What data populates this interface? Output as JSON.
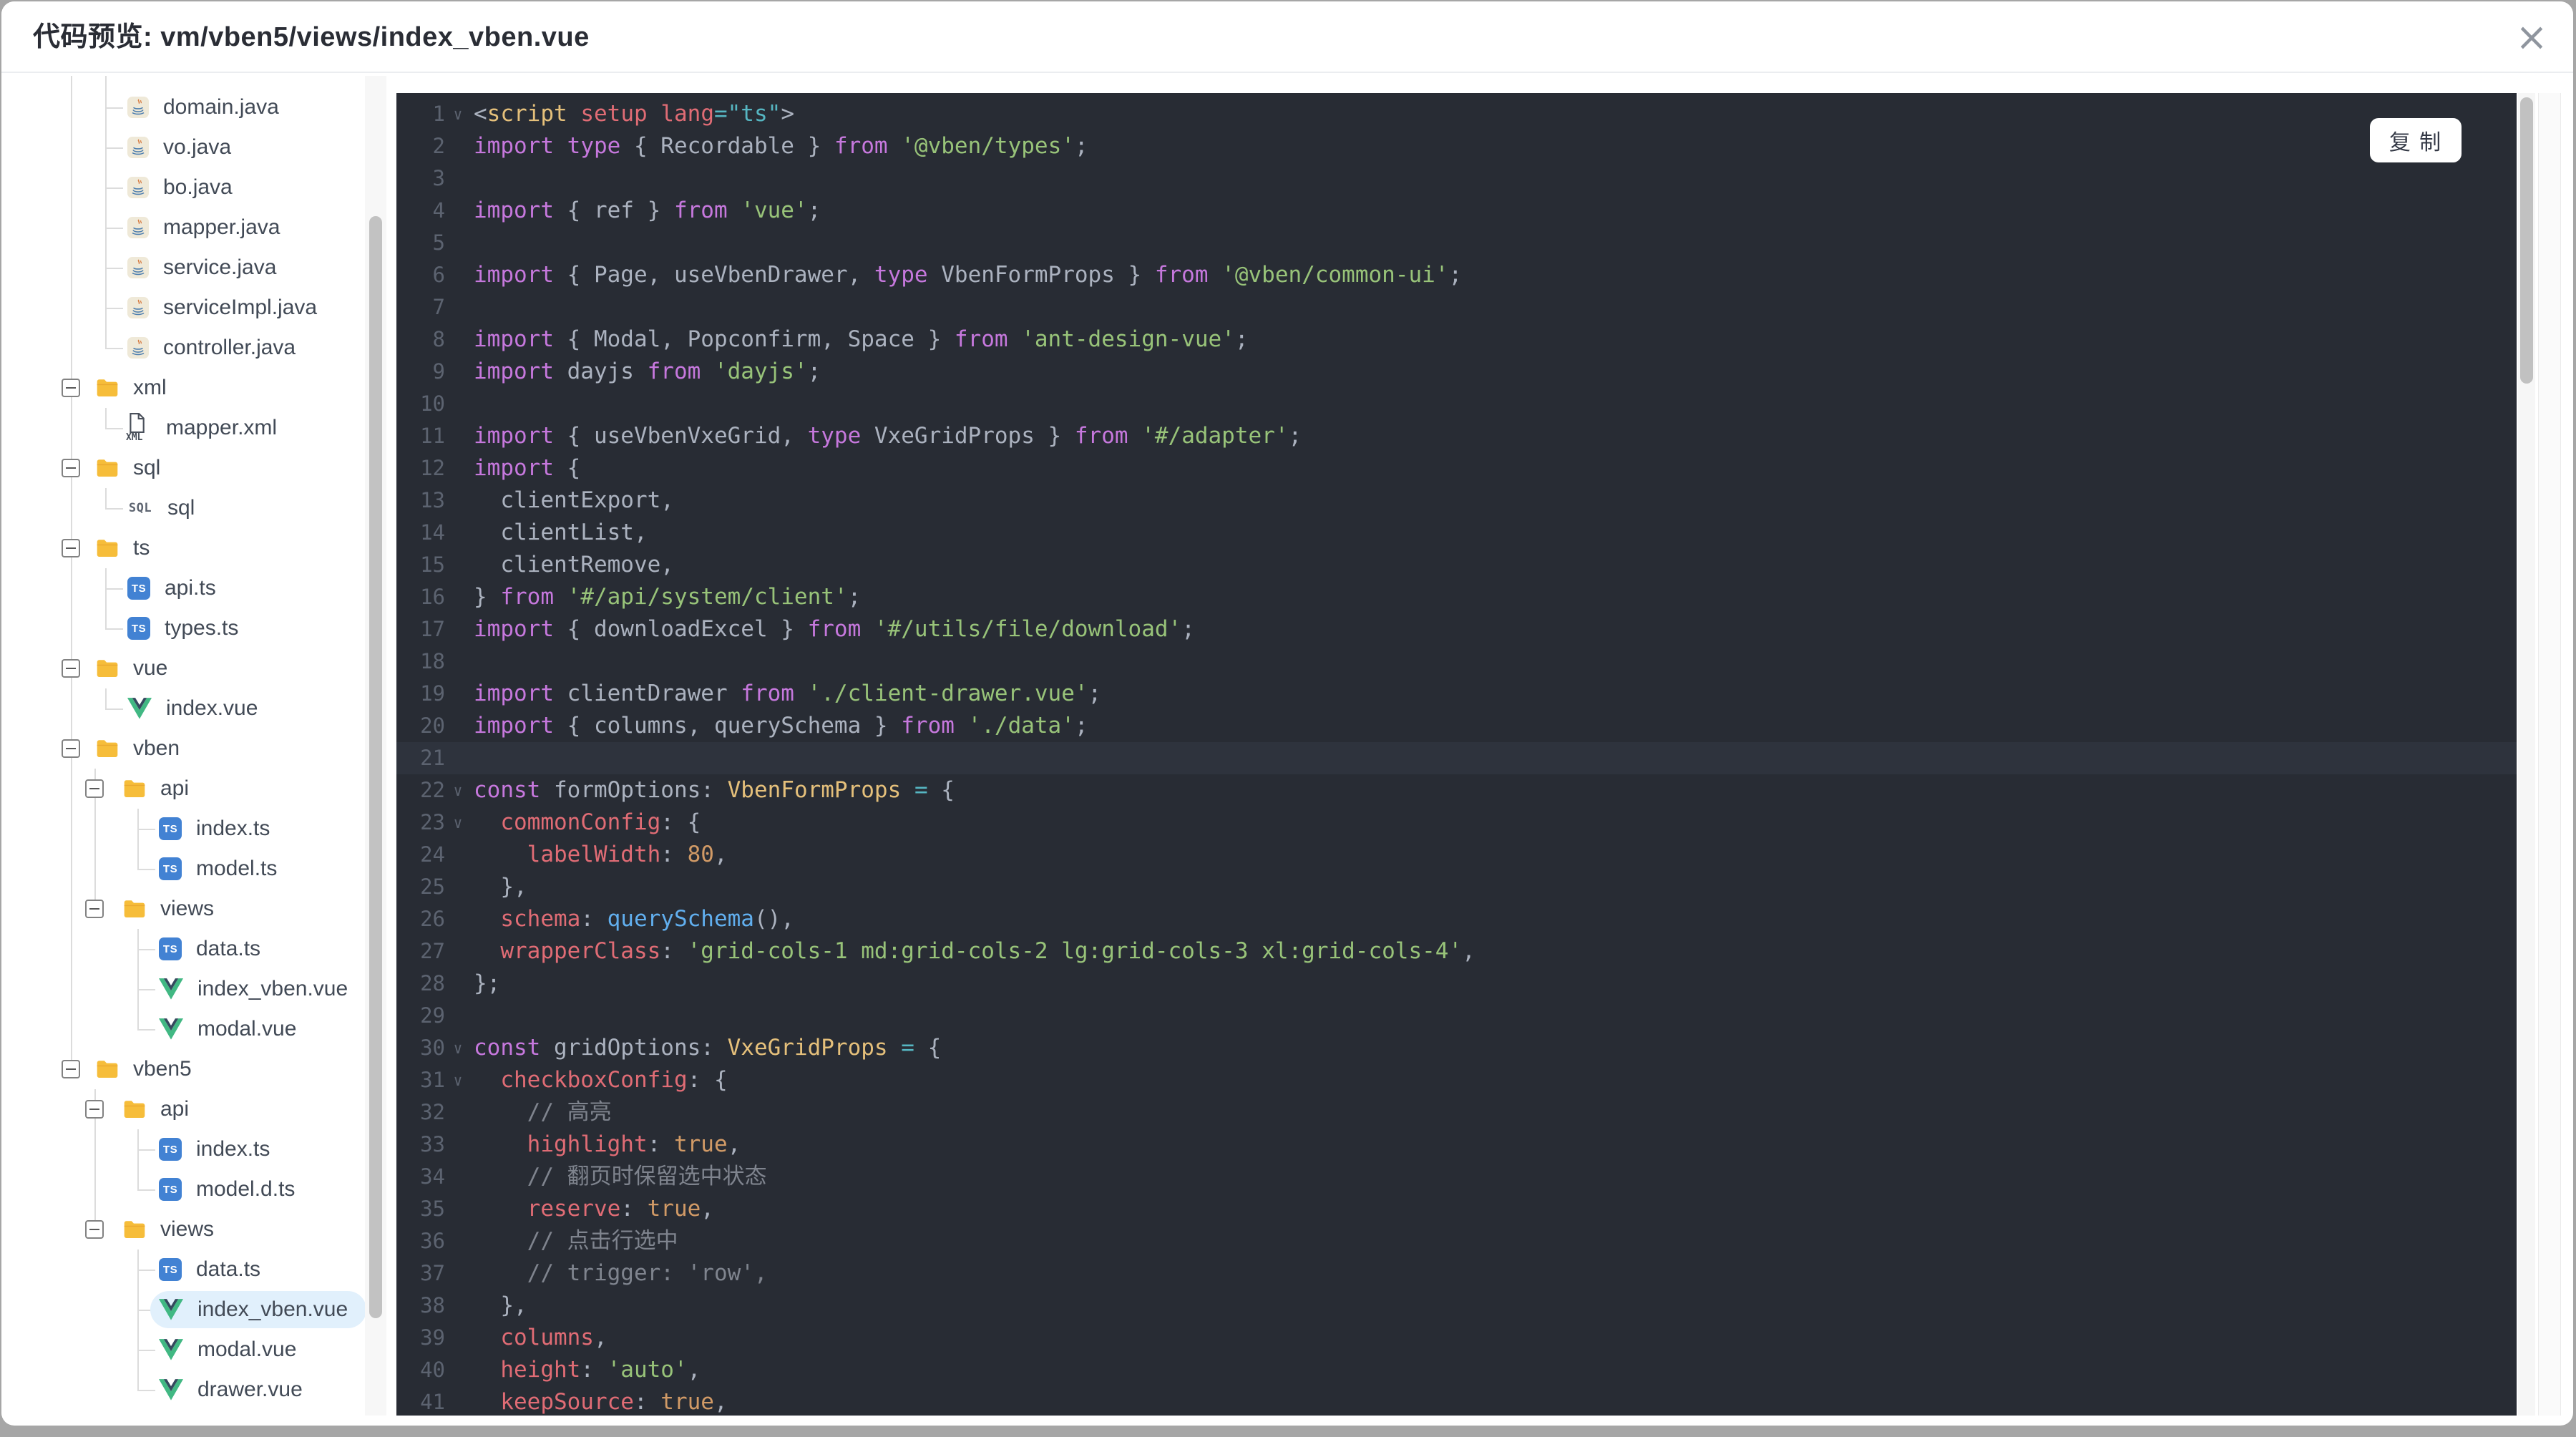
{
  "dialog": {
    "title": "代码预览: vm/vben5/views/index_vben.vue",
    "close_icon": "×"
  },
  "colors": {
    "editor_background": "#282c34",
    "selected_item_bg": "#e1f0fc",
    "folder_icon": "#f6bd3a",
    "ts_icon_bg": "#4282d3",
    "vue_icon_green": "#41b883",
    "vue_icon_dark": "#35495e",
    "syntax_keyword": "#c678dd",
    "syntax_string": "#98c379",
    "syntax_property": "#e06c75",
    "syntax_number": "#d19a66",
    "syntax_function": "#61afef",
    "syntax_type": "#e5c07b",
    "syntax_operator": "#56b6c2",
    "syntax_comment": "#7f848e"
  },
  "tree": {
    "items": [
      {
        "label": "domain.java",
        "kind": "java",
        "level": 1
      },
      {
        "label": "vo.java",
        "kind": "java",
        "level": 1
      },
      {
        "label": "bo.java",
        "kind": "java",
        "level": 1
      },
      {
        "label": "mapper.java",
        "kind": "java",
        "level": 1
      },
      {
        "label": "service.java",
        "kind": "java",
        "level": 1
      },
      {
        "label": "serviceImpl.java",
        "kind": "java",
        "level": 1
      },
      {
        "label": "controller.java",
        "kind": "java",
        "level": 1
      },
      {
        "label": "xml",
        "kind": "folder",
        "level": 0,
        "expander": true
      },
      {
        "label": "mapper.xml",
        "kind": "xml",
        "level": 1
      },
      {
        "label": "sql",
        "kind": "folder",
        "level": 0,
        "expander": true
      },
      {
        "label": "sql",
        "kind": "sql",
        "level": 1
      },
      {
        "label": "ts",
        "kind": "folder",
        "level": 0,
        "expander": true
      },
      {
        "label": "api.ts",
        "kind": "ts",
        "level": 1
      },
      {
        "label": "types.ts",
        "kind": "ts",
        "level": 1
      },
      {
        "label": "vue",
        "kind": "folder",
        "level": 0,
        "expander": true
      },
      {
        "label": "index.vue",
        "kind": "vue",
        "level": 1
      },
      {
        "label": "vben",
        "kind": "folder",
        "level": 0,
        "expander": true
      },
      {
        "label": "api",
        "kind": "folder",
        "level": 1,
        "expander": true
      },
      {
        "label": "index.ts",
        "kind": "ts",
        "level": 2
      },
      {
        "label": "model.ts",
        "kind": "ts",
        "level": 2
      },
      {
        "label": "views",
        "kind": "folder",
        "level": 1,
        "expander": true
      },
      {
        "label": "data.ts",
        "kind": "ts",
        "level": 2
      },
      {
        "label": "index_vben.vue",
        "kind": "vue",
        "level": 2
      },
      {
        "label": "modal.vue",
        "kind": "vue",
        "level": 2
      },
      {
        "label": "vben5",
        "kind": "folder",
        "level": 0,
        "expander": true
      },
      {
        "label": "api",
        "kind": "folder",
        "level": 1,
        "expander": true
      },
      {
        "label": "index.ts",
        "kind": "ts",
        "level": 2
      },
      {
        "label": "model.d.ts",
        "kind": "ts",
        "level": 2
      },
      {
        "label": "views",
        "kind": "folder",
        "level": 1,
        "expander": true
      },
      {
        "label": "data.ts",
        "kind": "ts",
        "level": 2
      },
      {
        "label": "index_vben.vue",
        "kind": "vue",
        "level": 2,
        "selected": true
      },
      {
        "label": "modal.vue",
        "kind": "vue",
        "level": 2
      },
      {
        "label": "drawer.vue",
        "kind": "vue",
        "level": 2
      }
    ]
  },
  "editor": {
    "copy_label": "复 制",
    "highlight_line": 21,
    "fold_lines": [
      1,
      22,
      23,
      30,
      31
    ],
    "fold_icon": "∨",
    "lines": [
      {
        "n": 1,
        "tokens": [
          [
            "pln",
            "<"
          ],
          [
            "typ",
            "script"
          ],
          [
            "pln",
            " "
          ],
          [
            "prop",
            "setup"
          ],
          [
            "pln",
            " "
          ],
          [
            "prop",
            "lang"
          ],
          [
            "op",
            "=\"ts\""
          ],
          [
            "pln",
            ">"
          ]
        ]
      },
      {
        "n": 2,
        "tokens": [
          [
            "kw",
            "import"
          ],
          [
            "pln",
            " "
          ],
          [
            "kw",
            "type"
          ],
          [
            "pln",
            " { Recordable } "
          ],
          [
            "kw",
            "from"
          ],
          [
            "pln",
            " "
          ],
          [
            "str",
            "'@vben/types'"
          ],
          [
            "pln",
            ";"
          ]
        ]
      },
      {
        "n": 3,
        "tokens": []
      },
      {
        "n": 4,
        "tokens": [
          [
            "kw",
            "import"
          ],
          [
            "pln",
            " { ref } "
          ],
          [
            "kw",
            "from"
          ],
          [
            "pln",
            " "
          ],
          [
            "str",
            "'vue'"
          ],
          [
            "pln",
            ";"
          ]
        ]
      },
      {
        "n": 5,
        "tokens": []
      },
      {
        "n": 6,
        "tokens": [
          [
            "kw",
            "import"
          ],
          [
            "pln",
            " { Page, useVbenDrawer, "
          ],
          [
            "kw",
            "type"
          ],
          [
            "pln",
            " VbenFormProps } "
          ],
          [
            "kw",
            "from"
          ],
          [
            "pln",
            " "
          ],
          [
            "str",
            "'@vben/common-ui'"
          ],
          [
            "pln",
            ";"
          ]
        ]
      },
      {
        "n": 7,
        "tokens": []
      },
      {
        "n": 8,
        "tokens": [
          [
            "kw",
            "import"
          ],
          [
            "pln",
            " { Modal, Popconfirm, Space } "
          ],
          [
            "kw",
            "from"
          ],
          [
            "pln",
            " "
          ],
          [
            "str",
            "'ant-design-vue'"
          ],
          [
            "pln",
            ";"
          ]
        ]
      },
      {
        "n": 9,
        "tokens": [
          [
            "kw",
            "import"
          ],
          [
            "pln",
            " dayjs "
          ],
          [
            "kw",
            "from"
          ],
          [
            "pln",
            " "
          ],
          [
            "str",
            "'dayjs'"
          ],
          [
            "pln",
            ";"
          ]
        ]
      },
      {
        "n": 10,
        "tokens": []
      },
      {
        "n": 11,
        "tokens": [
          [
            "kw",
            "import"
          ],
          [
            "pln",
            " { useVbenVxeGrid, "
          ],
          [
            "kw",
            "type"
          ],
          [
            "pln",
            " VxeGridProps } "
          ],
          [
            "kw",
            "from"
          ],
          [
            "pln",
            " "
          ],
          [
            "str",
            "'#/adapter'"
          ],
          [
            "pln",
            ";"
          ]
        ]
      },
      {
        "n": 12,
        "tokens": [
          [
            "kw",
            "import"
          ],
          [
            "pln",
            " {"
          ]
        ]
      },
      {
        "n": 13,
        "tokens": [
          [
            "pln",
            "  clientExport,"
          ]
        ]
      },
      {
        "n": 14,
        "tokens": [
          [
            "pln",
            "  clientList,"
          ]
        ]
      },
      {
        "n": 15,
        "tokens": [
          [
            "pln",
            "  clientRemove,"
          ]
        ]
      },
      {
        "n": 16,
        "tokens": [
          [
            "pln",
            "} "
          ],
          [
            "kw",
            "from"
          ],
          [
            "pln",
            " "
          ],
          [
            "str",
            "'#/api/system/client'"
          ],
          [
            "pln",
            ";"
          ]
        ]
      },
      {
        "n": 17,
        "tokens": [
          [
            "kw",
            "import"
          ],
          [
            "pln",
            " { downloadExcel } "
          ],
          [
            "kw",
            "from"
          ],
          [
            "pln",
            " "
          ],
          [
            "str",
            "'#/utils/file/download'"
          ],
          [
            "pln",
            ";"
          ]
        ]
      },
      {
        "n": 18,
        "tokens": []
      },
      {
        "n": 19,
        "tokens": [
          [
            "kw",
            "import"
          ],
          [
            "pln",
            " clientDrawer "
          ],
          [
            "kw",
            "from"
          ],
          [
            "pln",
            " "
          ],
          [
            "str",
            "'./client-drawer.vue'"
          ],
          [
            "pln",
            ";"
          ]
        ]
      },
      {
        "n": 20,
        "tokens": [
          [
            "kw",
            "import"
          ],
          [
            "pln",
            " { columns, querySchema } "
          ],
          [
            "kw",
            "from"
          ],
          [
            "pln",
            " "
          ],
          [
            "str",
            "'./data'"
          ],
          [
            "pln",
            ";"
          ]
        ]
      },
      {
        "n": 21,
        "tokens": []
      },
      {
        "n": 22,
        "tokens": [
          [
            "kw",
            "const"
          ],
          [
            "pln",
            " formOptions: "
          ],
          [
            "typ",
            "VbenFormProps"
          ],
          [
            "pln",
            " "
          ],
          [
            "op",
            "="
          ],
          [
            "pln",
            " {"
          ]
        ]
      },
      {
        "n": 23,
        "tokens": [
          [
            "pln",
            "  "
          ],
          [
            "prop",
            "commonConfig"
          ],
          [
            "pln",
            ": {"
          ]
        ]
      },
      {
        "n": 24,
        "tokens": [
          [
            "pln",
            "    "
          ],
          [
            "prop",
            "labelWidth"
          ],
          [
            "pln",
            ": "
          ],
          [
            "num",
            "80"
          ],
          [
            "pln",
            ","
          ]
        ]
      },
      {
        "n": 25,
        "tokens": [
          [
            "pln",
            "  },"
          ]
        ]
      },
      {
        "n": 26,
        "tokens": [
          [
            "pln",
            "  "
          ],
          [
            "prop",
            "schema"
          ],
          [
            "pln",
            ": "
          ],
          [
            "fn",
            "querySchema"
          ],
          [
            "pln",
            "(),"
          ]
        ]
      },
      {
        "n": 27,
        "tokens": [
          [
            "pln",
            "  "
          ],
          [
            "prop",
            "wrapperClass"
          ],
          [
            "pln",
            ": "
          ],
          [
            "str",
            "'grid-cols-1 md:grid-cols-2 lg:grid-cols-3 xl:grid-cols-4'"
          ],
          [
            "pln",
            ","
          ]
        ]
      },
      {
        "n": 28,
        "tokens": [
          [
            "pln",
            "};"
          ]
        ]
      },
      {
        "n": 29,
        "tokens": []
      },
      {
        "n": 30,
        "tokens": [
          [
            "kw",
            "const"
          ],
          [
            "pln",
            " gridOptions: "
          ],
          [
            "typ",
            "VxeGridProps"
          ],
          [
            "pln",
            " "
          ],
          [
            "op",
            "="
          ],
          [
            "pln",
            " {"
          ]
        ]
      },
      {
        "n": 31,
        "tokens": [
          [
            "pln",
            "  "
          ],
          [
            "prop",
            "checkboxConfig"
          ],
          [
            "pln",
            ": {"
          ]
        ]
      },
      {
        "n": 32,
        "tokens": [
          [
            "pln",
            "    "
          ],
          [
            "com",
            "// 高亮"
          ]
        ]
      },
      {
        "n": 33,
        "tokens": [
          [
            "pln",
            "    "
          ],
          [
            "prop",
            "highlight"
          ],
          [
            "pln",
            ": "
          ],
          [
            "num",
            "true"
          ],
          [
            "pln",
            ","
          ]
        ]
      },
      {
        "n": 34,
        "tokens": [
          [
            "pln",
            "    "
          ],
          [
            "com",
            "// 翻页时保留选中状态"
          ]
        ]
      },
      {
        "n": 35,
        "tokens": [
          [
            "pln",
            "    "
          ],
          [
            "prop",
            "reserve"
          ],
          [
            "pln",
            ": "
          ],
          [
            "num",
            "true"
          ],
          [
            "pln",
            ","
          ]
        ]
      },
      {
        "n": 36,
        "tokens": [
          [
            "pln",
            "    "
          ],
          [
            "com",
            "// 点击行选中"
          ]
        ]
      },
      {
        "n": 37,
        "tokens": [
          [
            "pln",
            "    "
          ],
          [
            "com",
            "// trigger: 'row',"
          ]
        ]
      },
      {
        "n": 38,
        "tokens": [
          [
            "pln",
            "  },"
          ]
        ]
      },
      {
        "n": 39,
        "tokens": [
          [
            "pln",
            "  "
          ],
          [
            "prop",
            "columns"
          ],
          [
            "pln",
            ","
          ]
        ]
      },
      {
        "n": 40,
        "tokens": [
          [
            "pln",
            "  "
          ],
          [
            "prop",
            "height"
          ],
          [
            "pln",
            ": "
          ],
          [
            "str",
            "'auto'"
          ],
          [
            "pln",
            ","
          ]
        ]
      },
      {
        "n": 41,
        "tokens": [
          [
            "pln",
            "  "
          ],
          [
            "prop",
            "keepSource"
          ],
          [
            "pln",
            ": "
          ],
          [
            "num",
            "true"
          ],
          [
            "pln",
            ","
          ]
        ]
      }
    ]
  }
}
